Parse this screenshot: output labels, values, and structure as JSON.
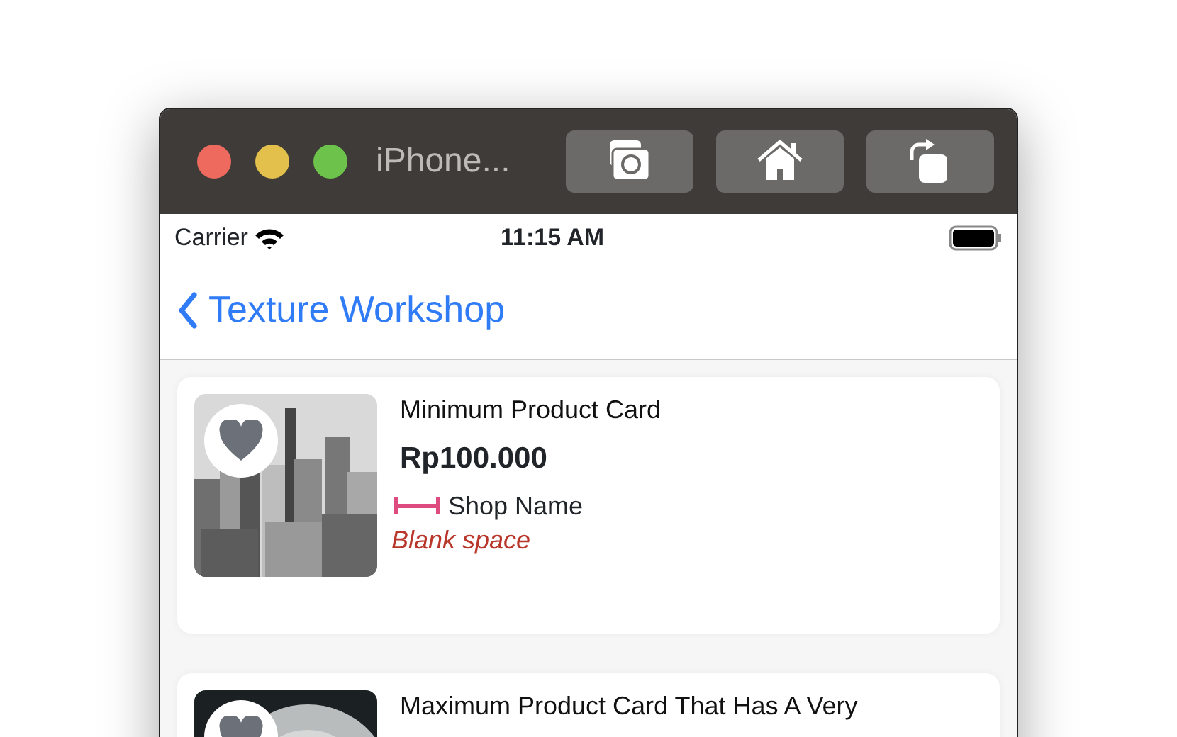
{
  "window": {
    "title": "iPhone...",
    "controls": [
      {
        "kind": "close"
      },
      {
        "kind": "minimize"
      },
      {
        "kind": "zoom"
      }
    ],
    "toolbar": [
      {
        "kind": "screenshot"
      },
      {
        "kind": "home"
      },
      {
        "kind": "rotate"
      }
    ]
  },
  "status_bar": {
    "carrier": "Carrier",
    "time": "11:15 AM"
  },
  "nav": {
    "back_title": "Texture Workshop"
  },
  "products": [
    {
      "name": "Minimum Product Card",
      "price": "Rp100.000",
      "shop": "Shop Name",
      "note": "Blank space",
      "favorite": false
    },
    {
      "name": "Maximum Product Card That Has A Very",
      "favorite": false
    }
  ]
}
